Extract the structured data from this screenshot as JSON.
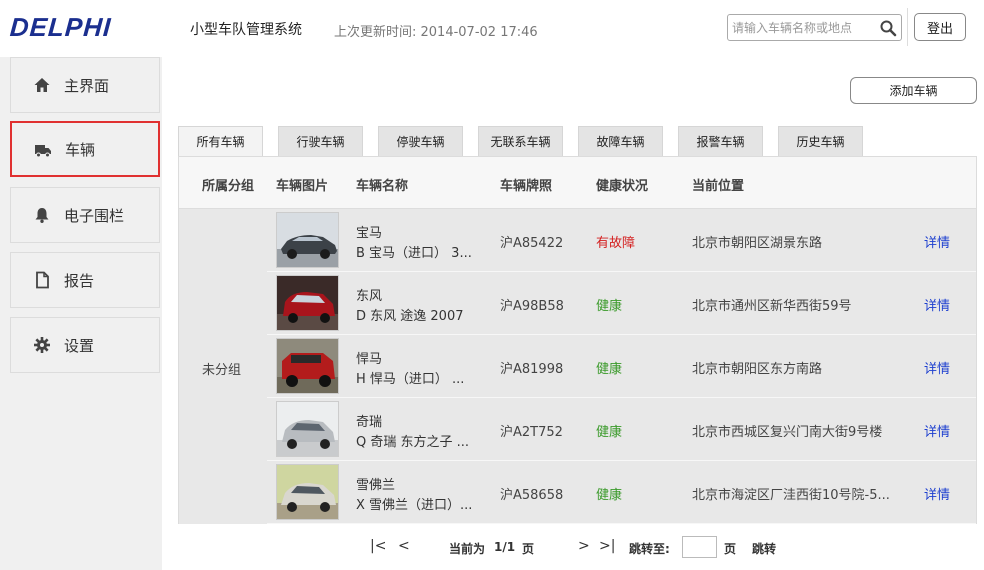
{
  "header": {
    "logo": "DELPHI",
    "app_title": "小型车队管理系统",
    "update_time": "上次更新时间: 2014-07-02 17:46",
    "search_placeholder": "请输入车辆名称或地点",
    "logout_label": "登出"
  },
  "sidebar": {
    "items": [
      {
        "label": "主界面",
        "icon": "home-icon"
      },
      {
        "label": "车辆",
        "icon": "truck-icon",
        "active": true
      },
      {
        "label": "电子围栏",
        "icon": "bell-icon"
      },
      {
        "label": "报告",
        "icon": "document-icon"
      },
      {
        "label": "设置",
        "icon": "gear-icon"
      }
    ]
  },
  "main": {
    "add_vehicle_label": "添加车辆",
    "tabs": [
      {
        "label": "所有车辆",
        "active": true
      },
      {
        "label": "行驶车辆"
      },
      {
        "label": "停驶车辆"
      },
      {
        "label": "无联系车辆"
      },
      {
        "label": "故障车辆"
      },
      {
        "label": "报警车辆"
      },
      {
        "label": "历史车辆"
      }
    ],
    "table": {
      "headers": [
        "所属分组",
        "车辆图片",
        "车辆名称",
        "车辆牌照",
        "健康状况",
        "当前位置"
      ],
      "group": "未分组",
      "rows": [
        {
          "name": "宝马",
          "sub": "B 宝马（进口） 3...",
          "plate": "沪A85422",
          "health": "有故障",
          "health_color": "#d42020",
          "location": "北京市朝阳区湖景东路",
          "detail": "详情"
        },
        {
          "name": "东风",
          "sub": "D 东风 途逸 2007",
          "plate": "沪A98B58",
          "health": "健康",
          "health_color": "#3a9a2a",
          "location": "北京市通州区新华西街59号",
          "detail": "详情"
        },
        {
          "name": "悍马",
          "sub": "H 悍马（进口） ...",
          "plate": "沪A81998",
          "health": "健康",
          "health_color": "#3a9a2a",
          "location": "北京市朝阳区东方南路",
          "detail": "详情"
        },
        {
          "name": "奇瑞",
          "sub": "Q 奇瑞 东方之子 ...",
          "plate": "沪A2T752",
          "health": "健康",
          "health_color": "#3a9a2a",
          "location": "北京市西城区复兴门南大街9号楼",
          "detail": "详情"
        },
        {
          "name": "雪佛兰",
          "sub": "X 雪佛兰（进口）...",
          "plate": "沪A58658",
          "health": "健康",
          "health_color": "#3a9a2a",
          "location": "北京市海淀区厂洼西街10号院-5...",
          "detail": "详情"
        }
      ]
    },
    "pager": {
      "first": "|<",
      "prev": "<",
      "current_label": "当前为",
      "page_value": "1/1",
      "page_suffix": "页",
      "next": ">",
      "last": ">|",
      "jump_label": "跳转至:",
      "jump_suffix": "页",
      "jump_button": "跳转"
    }
  },
  "colors": {
    "brand": "#1b2f8f",
    "active_border": "#e03030",
    "link": "#1d3fcf"
  }
}
